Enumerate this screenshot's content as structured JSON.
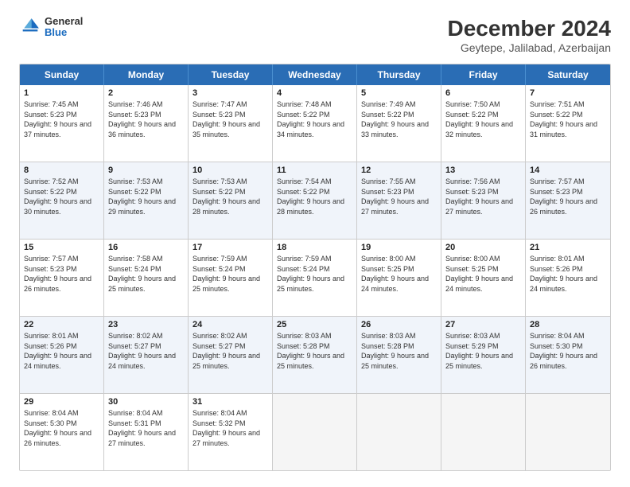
{
  "logo": {
    "line1": "General",
    "line2": "Blue"
  },
  "title": "December 2024",
  "subtitle": "Geytepe, Jalilabad, Azerbaijan",
  "headers": [
    "Sunday",
    "Monday",
    "Tuesday",
    "Wednesday",
    "Thursday",
    "Friday",
    "Saturday"
  ],
  "rows": [
    {
      "alt": false,
      "cells": [
        {
          "day": "1",
          "info": "Sunrise: 7:45 AM\nSunset: 5:23 PM\nDaylight: 9 hours and 37 minutes."
        },
        {
          "day": "2",
          "info": "Sunrise: 7:46 AM\nSunset: 5:23 PM\nDaylight: 9 hours and 36 minutes."
        },
        {
          "day": "3",
          "info": "Sunrise: 7:47 AM\nSunset: 5:23 PM\nDaylight: 9 hours and 35 minutes."
        },
        {
          "day": "4",
          "info": "Sunrise: 7:48 AM\nSunset: 5:22 PM\nDaylight: 9 hours and 34 minutes."
        },
        {
          "day": "5",
          "info": "Sunrise: 7:49 AM\nSunset: 5:22 PM\nDaylight: 9 hours and 33 minutes."
        },
        {
          "day": "6",
          "info": "Sunrise: 7:50 AM\nSunset: 5:22 PM\nDaylight: 9 hours and 32 minutes."
        },
        {
          "day": "7",
          "info": "Sunrise: 7:51 AM\nSunset: 5:22 PM\nDaylight: 9 hours and 31 minutes."
        }
      ]
    },
    {
      "alt": true,
      "cells": [
        {
          "day": "8",
          "info": "Sunrise: 7:52 AM\nSunset: 5:22 PM\nDaylight: 9 hours and 30 minutes."
        },
        {
          "day": "9",
          "info": "Sunrise: 7:53 AM\nSunset: 5:22 PM\nDaylight: 9 hours and 29 minutes."
        },
        {
          "day": "10",
          "info": "Sunrise: 7:53 AM\nSunset: 5:22 PM\nDaylight: 9 hours and 28 minutes."
        },
        {
          "day": "11",
          "info": "Sunrise: 7:54 AM\nSunset: 5:22 PM\nDaylight: 9 hours and 28 minutes."
        },
        {
          "day": "12",
          "info": "Sunrise: 7:55 AM\nSunset: 5:23 PM\nDaylight: 9 hours and 27 minutes."
        },
        {
          "day": "13",
          "info": "Sunrise: 7:56 AM\nSunset: 5:23 PM\nDaylight: 9 hours and 27 minutes."
        },
        {
          "day": "14",
          "info": "Sunrise: 7:57 AM\nSunset: 5:23 PM\nDaylight: 9 hours and 26 minutes."
        }
      ]
    },
    {
      "alt": false,
      "cells": [
        {
          "day": "15",
          "info": "Sunrise: 7:57 AM\nSunset: 5:23 PM\nDaylight: 9 hours and 26 minutes."
        },
        {
          "day": "16",
          "info": "Sunrise: 7:58 AM\nSunset: 5:24 PM\nDaylight: 9 hours and 25 minutes."
        },
        {
          "day": "17",
          "info": "Sunrise: 7:59 AM\nSunset: 5:24 PM\nDaylight: 9 hours and 25 minutes."
        },
        {
          "day": "18",
          "info": "Sunrise: 7:59 AM\nSunset: 5:24 PM\nDaylight: 9 hours and 25 minutes."
        },
        {
          "day": "19",
          "info": "Sunrise: 8:00 AM\nSunset: 5:25 PM\nDaylight: 9 hours and 24 minutes."
        },
        {
          "day": "20",
          "info": "Sunrise: 8:00 AM\nSunset: 5:25 PM\nDaylight: 9 hours and 24 minutes."
        },
        {
          "day": "21",
          "info": "Sunrise: 8:01 AM\nSunset: 5:26 PM\nDaylight: 9 hours and 24 minutes."
        }
      ]
    },
    {
      "alt": true,
      "cells": [
        {
          "day": "22",
          "info": "Sunrise: 8:01 AM\nSunset: 5:26 PM\nDaylight: 9 hours and 24 minutes."
        },
        {
          "day": "23",
          "info": "Sunrise: 8:02 AM\nSunset: 5:27 PM\nDaylight: 9 hours and 24 minutes."
        },
        {
          "day": "24",
          "info": "Sunrise: 8:02 AM\nSunset: 5:27 PM\nDaylight: 9 hours and 25 minutes."
        },
        {
          "day": "25",
          "info": "Sunrise: 8:03 AM\nSunset: 5:28 PM\nDaylight: 9 hours and 25 minutes."
        },
        {
          "day": "26",
          "info": "Sunrise: 8:03 AM\nSunset: 5:28 PM\nDaylight: 9 hours and 25 minutes."
        },
        {
          "day": "27",
          "info": "Sunrise: 8:03 AM\nSunset: 5:29 PM\nDaylight: 9 hours and 25 minutes."
        },
        {
          "day": "28",
          "info": "Sunrise: 8:04 AM\nSunset: 5:30 PM\nDaylight: 9 hours and 26 minutes."
        }
      ]
    },
    {
      "alt": false,
      "cells": [
        {
          "day": "29",
          "info": "Sunrise: 8:04 AM\nSunset: 5:30 PM\nDaylight: 9 hours and 26 minutes."
        },
        {
          "day": "30",
          "info": "Sunrise: 8:04 AM\nSunset: 5:31 PM\nDaylight: 9 hours and 27 minutes."
        },
        {
          "day": "31",
          "info": "Sunrise: 8:04 AM\nSunset: 5:32 PM\nDaylight: 9 hours and 27 minutes."
        },
        {
          "day": "",
          "info": ""
        },
        {
          "day": "",
          "info": ""
        },
        {
          "day": "",
          "info": ""
        },
        {
          "day": "",
          "info": ""
        }
      ]
    }
  ]
}
